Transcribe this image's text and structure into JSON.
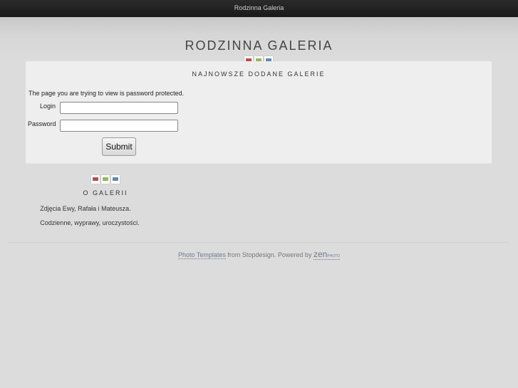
{
  "window": {
    "title": "Rodzinna Galeria"
  },
  "header": {
    "site_title": "RODZINNA GALERIA"
  },
  "gallery": {
    "heading": "NAJNOWSZE DODANE GALERIE"
  },
  "login_form": {
    "message": "The page you are trying to view is password protected.",
    "login_label": "Login",
    "login_value": "",
    "password_label": "Password",
    "password_value": "",
    "submit_label": "Submit"
  },
  "about": {
    "heading": "O GALERII",
    "line1": "Zdjęcia Ewy, Rafała i Mateusza.",
    "line2": "Codzienne, wyprawy, uroczystości."
  },
  "footer": {
    "templates_link": "Photo Templates",
    "from_text": " from Stopdesign. Powered by ",
    "zen_text": "zen",
    "zen_small": "PHOTO"
  },
  "icons": {
    "squares": [
      "red-square-icon",
      "green-square-icon",
      "blue-square-icon"
    ]
  },
  "colors": {
    "square_red": "#b3504f",
    "square_green": "#99b65a",
    "square_blue": "#5c8cb0"
  }
}
